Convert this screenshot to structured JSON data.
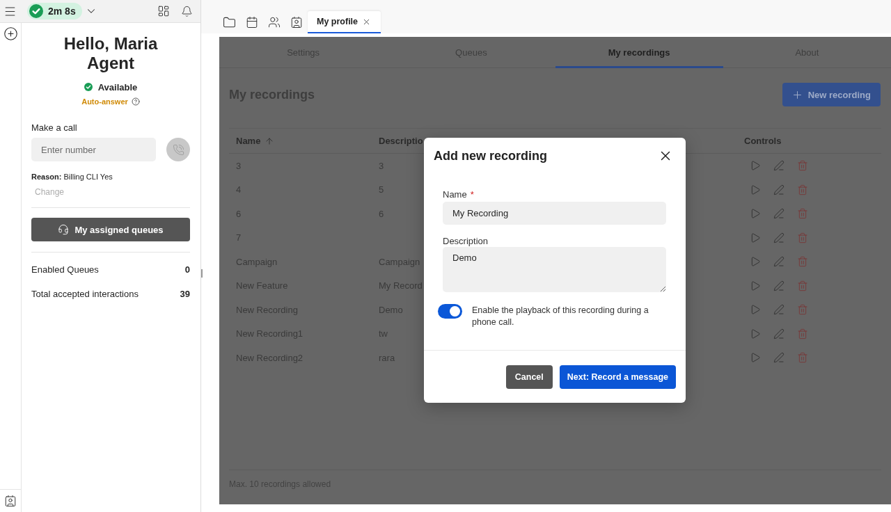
{
  "top_bar": {
    "timer": "2m 8s"
  },
  "agent": {
    "greeting": "Hello, Maria Agent",
    "status": "Available",
    "auto_answer": "Auto-answer"
  },
  "make_call": {
    "label": "Make a call",
    "placeholder": "Enter number",
    "reason": "**Reason:** Billing CLI Yes",
    "change_link": "Change"
  },
  "queues_button": "My assigned queues",
  "stats": [
    {
      "label": "Enabled Queues",
      "value": "0"
    },
    {
      "label": "Total accepted interactions",
      "value": "39"
    }
  ],
  "workspace_tabs": [
    {
      "label": "My profile",
      "selected": true
    }
  ],
  "profile_tabs": [
    {
      "label": "Settings",
      "selected": false
    },
    {
      "label": "Queues",
      "selected": false
    },
    {
      "label": "My recordings",
      "selected": true
    },
    {
      "label": "About",
      "selected": false
    }
  ],
  "page": {
    "title": "My recordings",
    "new_button": "New recording"
  },
  "table": {
    "columns": [
      {
        "label": "Name",
        "sorted": true
      },
      {
        "label": "Descriptio",
        "sorted": false
      },
      {
        "label": "Controls",
        "sorted": false
      }
    ],
    "rows": [
      {
        "name": "3",
        "description": "3"
      },
      {
        "name": "4",
        "description": "5"
      },
      {
        "name": "6",
        "description": "6"
      },
      {
        "name": "7"
      },
      {
        "name": "Campaign",
        "description": "Campaign"
      },
      {
        "name": "New Feature",
        "description": "My Record"
      },
      {
        "name": "New Recording",
        "description": "Demo"
      },
      {
        "name": "New Recording1",
        "description": "tw"
      },
      {
        "name": "New Recording2",
        "description": "rara"
      }
    ]
  },
  "footer_note": "Max. 10 recordings allowed",
  "dialog": {
    "title": "Add new recording",
    "fields": [
      {
        "kind": "input",
        "label": "Name",
        "required_mark": "*",
        "value": "My Recording"
      },
      {
        "kind": "textarea",
        "label": "Description",
        "value": "Demo"
      }
    ],
    "playback_toggle": {
      "on": true,
      "label": "Enable the playback of this recording during a phone call."
    },
    "buttons": [
      {
        "kind": "secondary",
        "label": "Cancel"
      },
      {
        "kind": "primary",
        "label": "Next: Record a message"
      }
    ]
  }
}
